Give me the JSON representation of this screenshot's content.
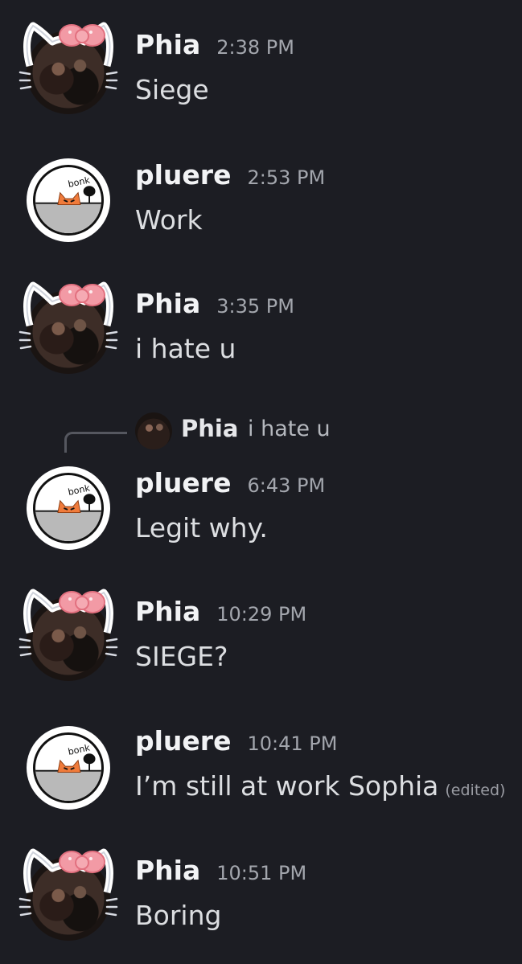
{
  "messages": [
    {
      "author": "Phia",
      "time": "2:38 PM",
      "text": "Siege",
      "avatar": "hello-kitty-couple-avatar"
    },
    {
      "author": "pluere",
      "time": "2:53 PM",
      "text": "Work",
      "avatar": "bonk-cat-avatar"
    },
    {
      "author": "Phia",
      "time": "3:35 PM",
      "text": "i hate u",
      "avatar": "hello-kitty-couple-avatar"
    },
    {
      "author": "pluere",
      "time": "6:43 PM",
      "text": "Legit why.",
      "avatar": "bonk-cat-avatar",
      "reply_to": {
        "author": "Phia",
        "text": "i hate u"
      }
    },
    {
      "author": "Phia",
      "time": "10:29 PM",
      "text": "SIEGE?",
      "avatar": "hello-kitty-couple-avatar"
    },
    {
      "author": "pluere",
      "time": "10:41 PM",
      "text": "I’m still at work Sophia",
      "edited": "(edited)",
      "avatar": "bonk-cat-avatar"
    },
    {
      "author": "Phia",
      "time": "10:51 PM",
      "text": "Boring",
      "avatar": "hello-kitty-couple-avatar"
    }
  ],
  "bonk_avatar_text": "bonk",
  "colors": {
    "background": "#1c1d23",
    "username": "#f2f3f5",
    "timestamp": "#a3a6ad",
    "message": "#dcdee1",
    "bow": "#f29aa5"
  }
}
